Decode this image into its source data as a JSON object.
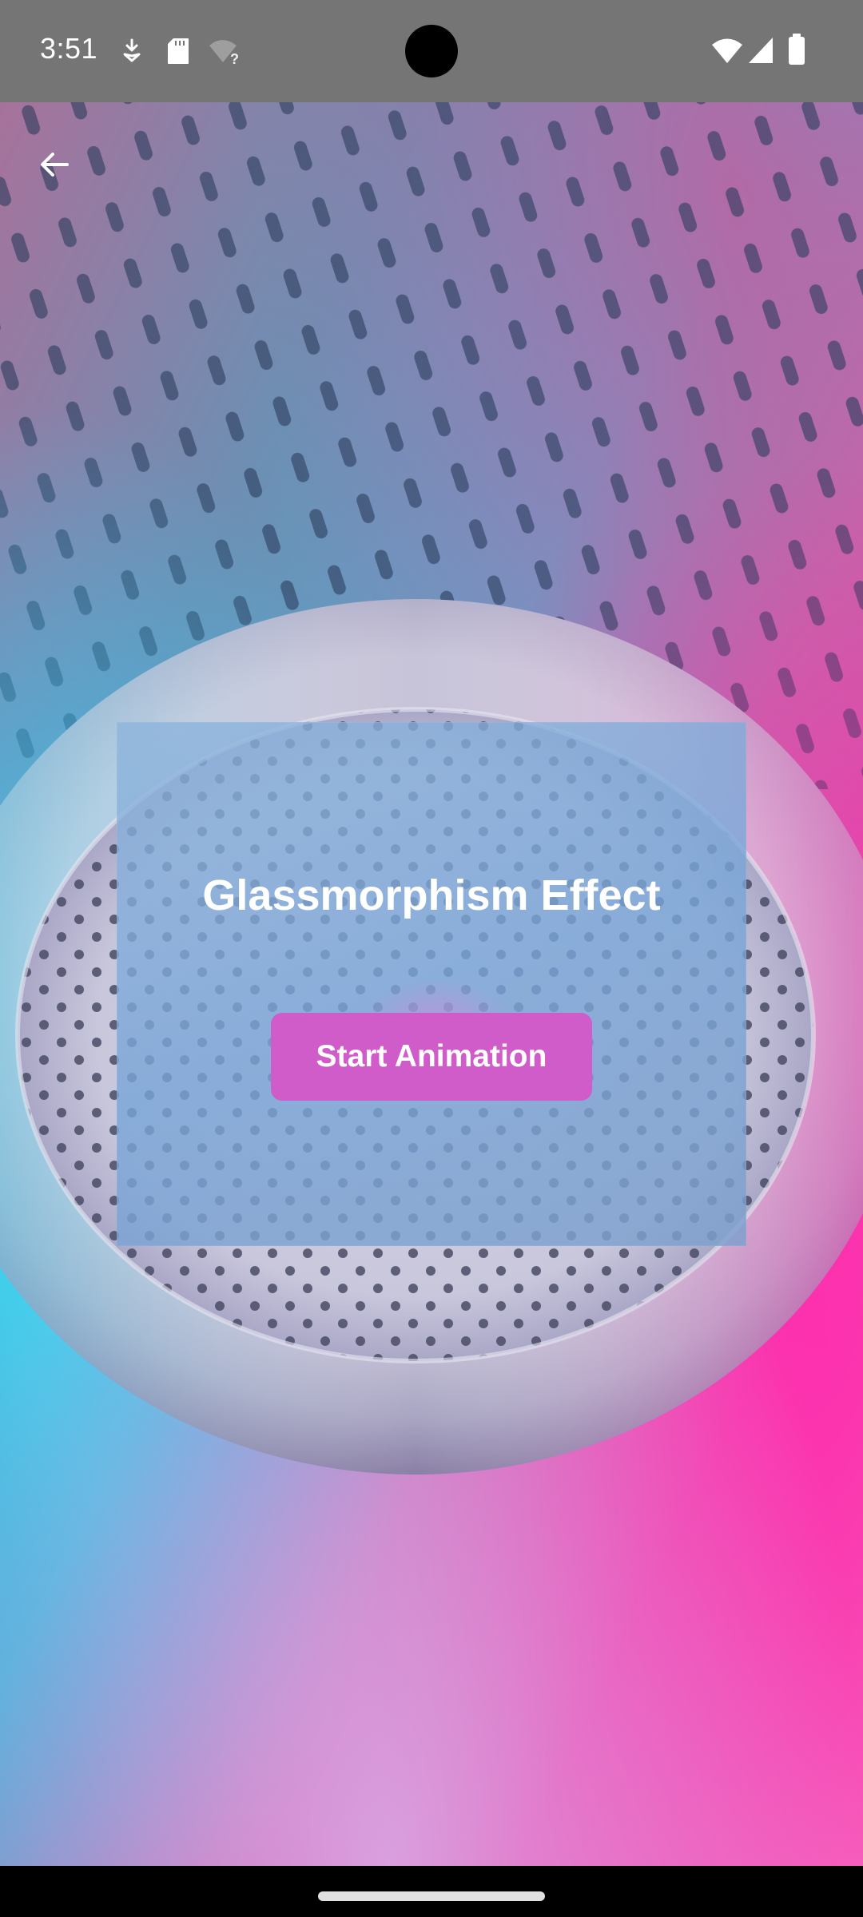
{
  "status_bar": {
    "time": "3:51",
    "left_icons": [
      "download-notification-icon",
      "sd-card-icon",
      "wifi-unknown-icon"
    ],
    "right_icons": [
      "wifi-icon",
      "cellular-signal-icon",
      "battery-icon"
    ],
    "background_color": "#757575"
  },
  "toolbar": {
    "back_icon": "arrow-back-icon"
  },
  "card": {
    "title": "Glassmorphism Effect",
    "button_label": "Start Animation",
    "button_color": "#cf5cc9"
  },
  "colors": {
    "accent_pink": "#ee3aa8",
    "accent_cyan": "#38d6f0",
    "glass": "#86aed8"
  }
}
